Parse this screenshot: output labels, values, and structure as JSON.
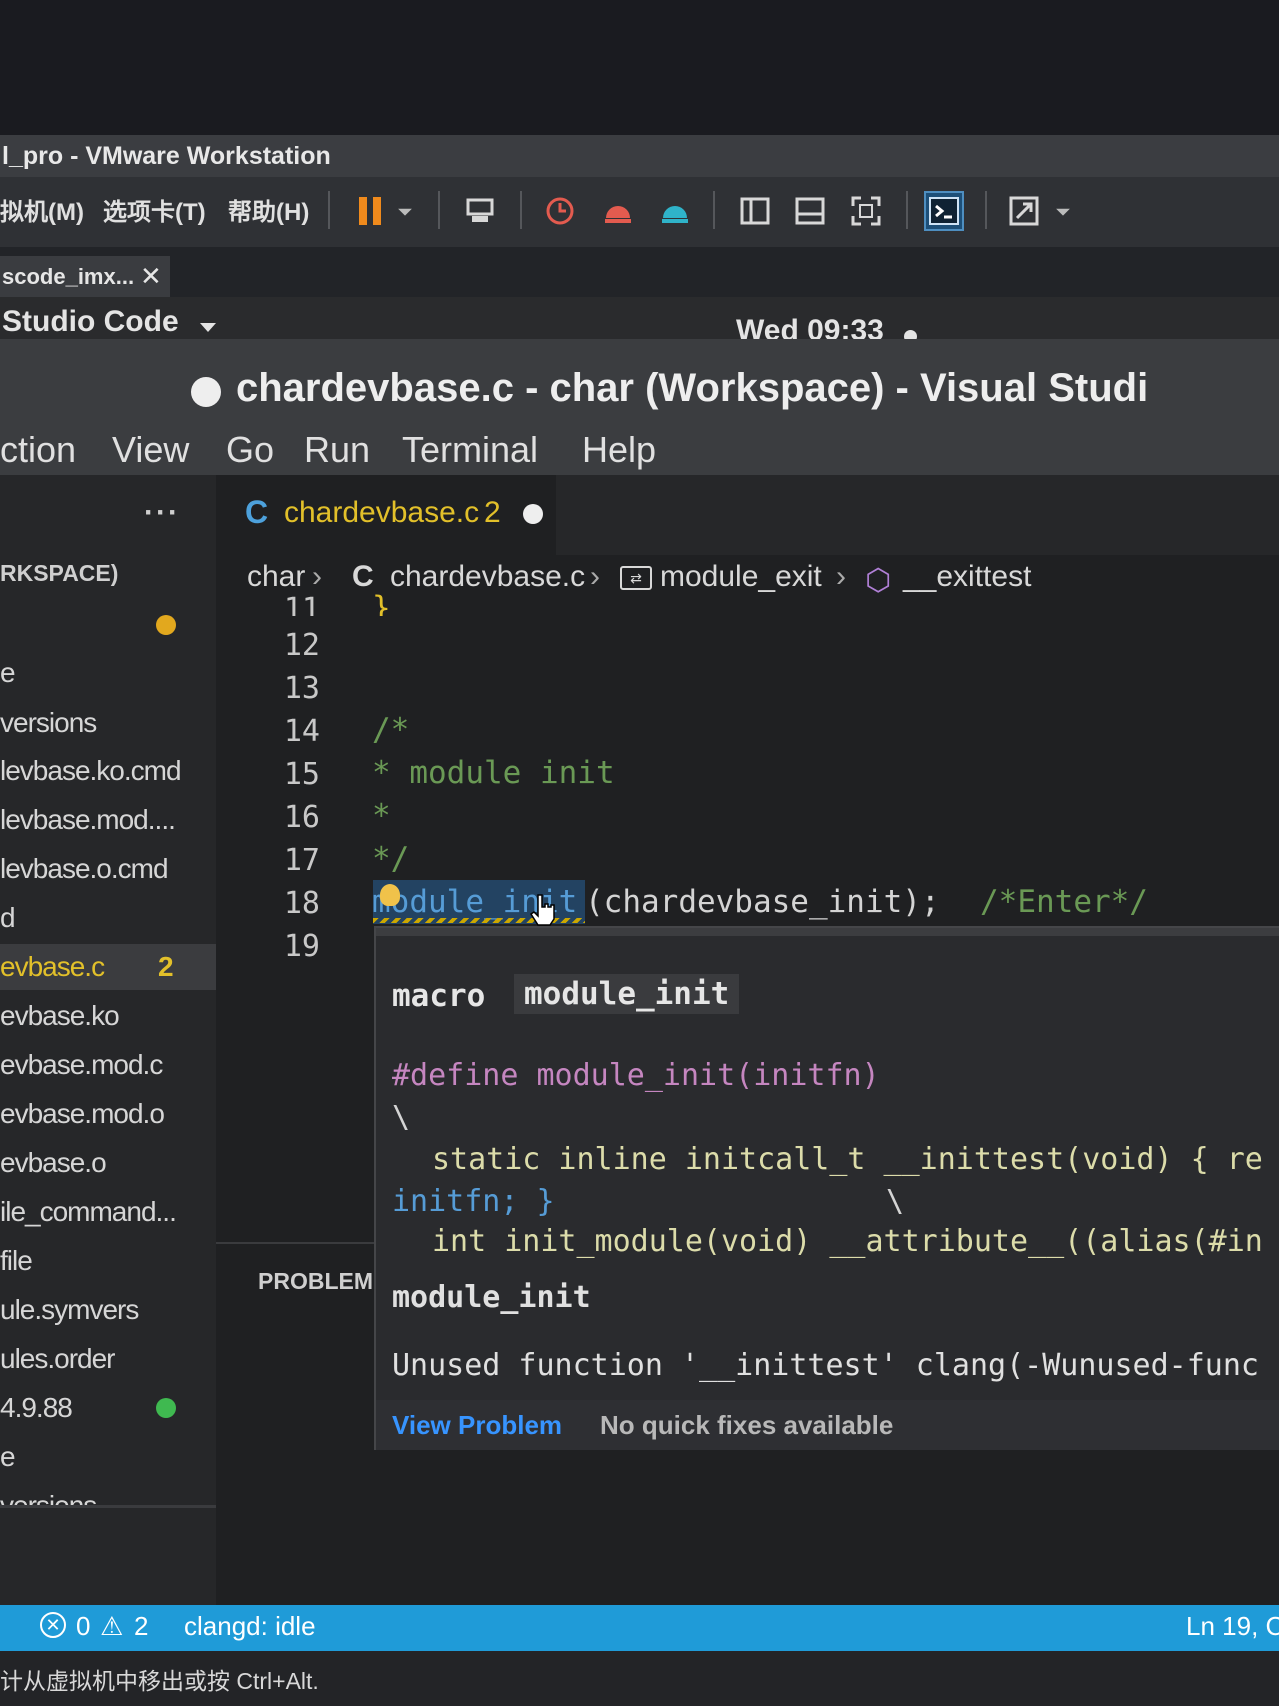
{
  "vmware": {
    "window_title": "l_pro - VMware Workstation",
    "menu": [
      "拟机(M)",
      "选项卡(T)",
      "帮助(H)"
    ],
    "vm_tab_label": "scode_imx...",
    "hint_text": "计从虚拟机中移出或按 Ctrl+Alt."
  },
  "ubuntu": {
    "app_menu": "Studio Code",
    "clock": "Wed 09:33"
  },
  "vscode": {
    "window_title": "chardevbase.c - char (Workspace) - Visual Studi",
    "menu": [
      "ction",
      "View",
      "Go",
      "Run",
      "Terminal",
      "Help"
    ],
    "sidebar": {
      "more": "···",
      "workspace_header": "RKSPACE)",
      "files": [
        {
          "label": "",
          "dot": "#e2a81e"
        },
        {
          "label": "e"
        },
        {
          "label": "versions"
        },
        {
          "label": "levbase.ko.cmd"
        },
        {
          "label": "levbase.mod...."
        },
        {
          "label": "levbase.o.cmd"
        },
        {
          "label": "d"
        },
        {
          "label": "evbase.c",
          "badge": "2",
          "active": true
        },
        {
          "label": "evbase.ko"
        },
        {
          "label": "evbase.mod.c"
        },
        {
          "label": "evbase.mod.o"
        },
        {
          "label": "evbase.o"
        },
        {
          "label": "ile_command..."
        },
        {
          "label": "file"
        },
        {
          "label": "ule.symvers"
        },
        {
          "label": "ules.order"
        },
        {
          "label": "4.9.88",
          "dot": "#3fb950"
        },
        {
          "label": "e"
        },
        {
          "label": "versions"
        }
      ]
    },
    "tab": {
      "icon": "C",
      "label": "chardevbase.c",
      "badge": "2"
    },
    "breadcrumb": {
      "folder": "char",
      "file": "chardevbase.c",
      "symbol1": "module_exit",
      "symbol2": "__exittest"
    },
    "code": {
      "line_numbers": [
        "11",
        "12",
        "13",
        "14",
        "15",
        "16",
        "17",
        "18",
        "19"
      ],
      "line_11": "}",
      "line_14": "/*",
      "line_15": "* module init",
      "line_16": "*",
      "line_17": "*/",
      "line_18_macro": "module_init",
      "line_18_args": "(chardevbase_init);",
      "line_18_comment": "/*Enter*/"
    },
    "hover": {
      "kind": "macro",
      "name": "module_init",
      "define": "#define module_init(initfn)",
      "backslash": "\\",
      "body1": "static inline initcall_t __inittest(void) { re",
      "body2": "initfn; }",
      "body2_bs": "\\",
      "body3": "int init_module(void) __attribute__((alias(#in",
      "expansion": "module_init",
      "diagnostic": "Unused function '__inittest' clang(-Wunused-func",
      "view_problem": "View Problem",
      "no_fixes": "No quick fixes available"
    },
    "panel_label": "PROBLEM",
    "status": {
      "errors": "0",
      "warnings": "2",
      "clangd": "clangd: idle",
      "position": "Ln 19, C"
    },
    "colors": {
      "statusbar": "#1f9bd8",
      "modified": "#e2c02a",
      "comment": "#6a9955",
      "keyword": "#569cd6",
      "function": "#dcdcaa"
    }
  }
}
